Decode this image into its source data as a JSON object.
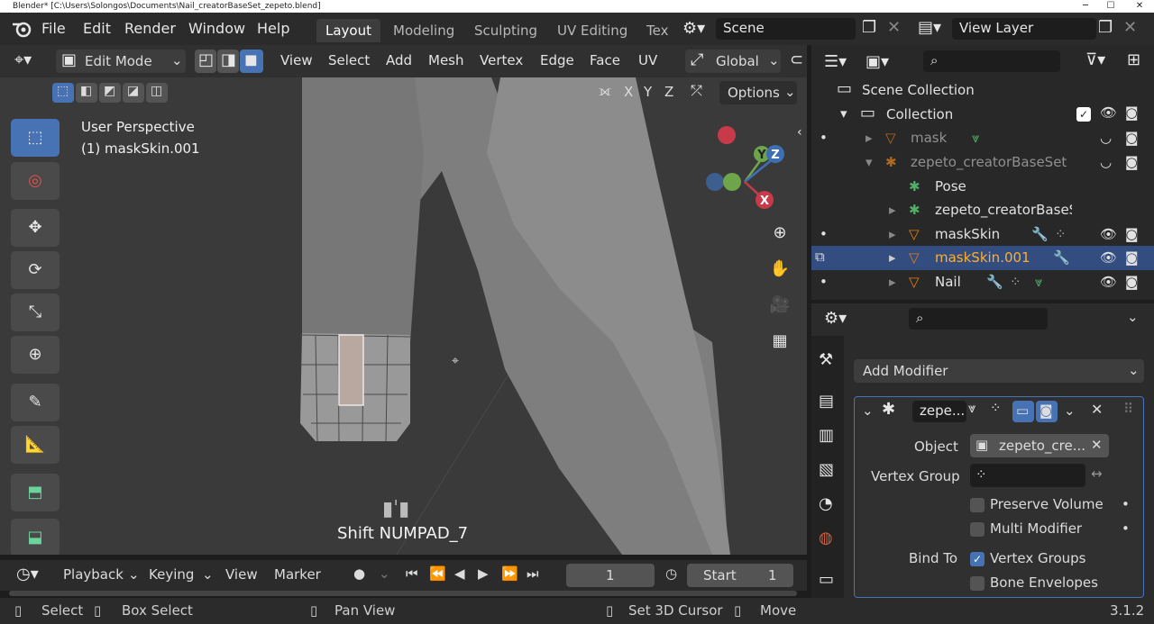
{
  "titlebar": {
    "title": "Blender* [C:\\Users\\Solongos\\Documents\\Nail_creatorBaseSet_zepeto.blend]",
    "min": "─",
    "max": "☐",
    "close": "✕"
  },
  "menu": {
    "file": "File",
    "edit": "Edit",
    "render": "Render",
    "window": "Window",
    "help": "Help"
  },
  "workspaces": [
    "Layout",
    "Modeling",
    "Sculpting",
    "UV Editing",
    "Tex"
  ],
  "scene": {
    "label": "Scene",
    "view_layer": "View Layer"
  },
  "viewport_header": {
    "mode": "Edit Mode",
    "menus": [
      "View",
      "Select",
      "Add",
      "Mesh",
      "Vertex",
      "Edge",
      "Face",
      "UV"
    ],
    "orientation": "Global",
    "axes": [
      "X",
      "Y",
      "Z"
    ],
    "options": "Options"
  },
  "overlay": {
    "perspective": "User Perspective",
    "object": "(1) maskSkin.001",
    "key_hint": "Shift NUMPAD_7"
  },
  "gizmo": {
    "x": "X",
    "y": "Y",
    "z": "Z"
  },
  "outliner": {
    "scene_collection": "Scene Collection",
    "collection": "Collection",
    "items": [
      {
        "label": "mask",
        "dim": true
      },
      {
        "label": "zepeto_creatorBaseSet",
        "dim": true
      },
      {
        "label": "Pose"
      },
      {
        "label": "zepeto_creatorBaseSe"
      },
      {
        "label": "maskSkin"
      },
      {
        "label": "maskSkin.001",
        "selected": true
      },
      {
        "label": "Nail"
      }
    ]
  },
  "properties": {
    "add_modifier": "Add Modifier",
    "modifier_name": "zepe...",
    "object_label": "Object",
    "object_value": "zepeto_cre...",
    "vertex_group_label": "Vertex Group",
    "preserve_volume": "Preserve Volume",
    "multi_modifier": "Multi Modifier",
    "bind_to_label": "Bind To",
    "vertex_groups": "Vertex Groups",
    "bone_envelopes": "Bone Envelopes"
  },
  "timeline": {
    "playback": "Playback",
    "keying": "Keying",
    "view": "View",
    "marker": "Marker",
    "frame": "1",
    "start_label": "Start",
    "start_value": "1"
  },
  "status": {
    "select": "Select",
    "box_select": "Box Select",
    "pan_view": "Pan View",
    "set_cursor": "Set 3D Cursor",
    "move": "Move",
    "version": "3.1.2"
  },
  "colors": {
    "accent": "#4772b3",
    "selected_row": "#334d80",
    "active_text": "#ffaf29",
    "mesh_orange": "#e87d0d"
  }
}
